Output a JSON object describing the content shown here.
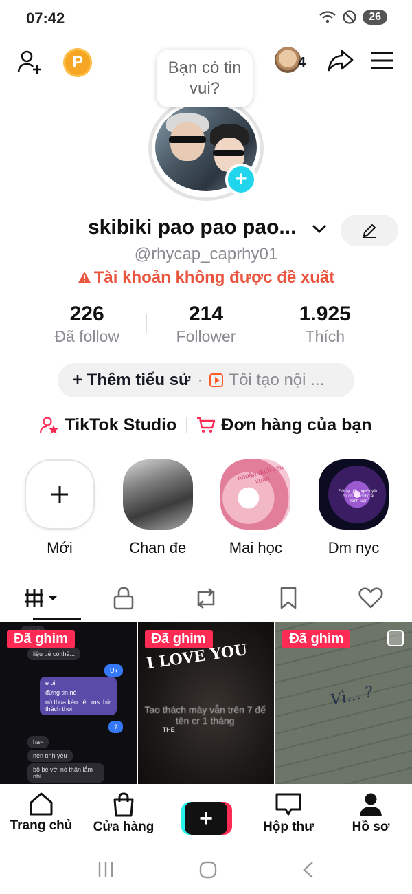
{
  "status_bar": {
    "time": "07:42",
    "battery": "26"
  },
  "top_bar": {
    "coin_label": "P",
    "friends_count": "4"
  },
  "avatar": {
    "bubble_text": "Bạn có tin vui?"
  },
  "profile": {
    "display_name": "skibiki pao pao pao...",
    "handle": "@rhycap_caprhy01",
    "warning": "Tài khoản không được đề xuất"
  },
  "stats": [
    {
      "value": "226",
      "label": "Đã follow"
    },
    {
      "value": "214",
      "label": "Follower"
    },
    {
      "value": "1.925",
      "label": "Thích"
    }
  ],
  "bio": {
    "add_label": "+ Thêm tiểu sử",
    "separator": "·",
    "creator_label": "Tôi tạo nội ..."
  },
  "links": {
    "studio": "TikTok Studio",
    "orders": "Đơn hàng của bạn"
  },
  "highlights": [
    {
      "label": "Mới"
    },
    {
      "label": "Chan đe"
    },
    {
      "label": "Mai học"
    },
    {
      "label": "Dm nyc"
    }
  ],
  "highlight_texts": {
    "mai_hoc": "nhuận đuổi cậu xuân",
    "dm_nyc": "Đời lại gặp người yêu cũ có thể cùng ai tranh luận"
  },
  "videos": [
    {
      "pin": "Đã ghim",
      "messages": [
        "pé oi",
        "liệu pé có thể...",
        "Uk",
        "e oi",
        "đừng tin nó",
        "nó thua kèo nên ms thử thách thoi",
        "?",
        "ha~",
        "nên tình yêu",
        "bộ bé với nó thân lắm nhỉ"
      ]
    },
    {
      "pin": "Đã ghim",
      "title": "I LOVE YOU",
      "caption": "Tao thách mày vẫn trên 7 để tên cr 1 tháng",
      "tag": "THE"
    },
    {
      "pin": "Đã ghim",
      "handwriting": "Vì... ?"
    }
  ],
  "bottom_nav": [
    {
      "label": "Trang chủ"
    },
    {
      "label": "Cửa hàng"
    },
    {
      "label": ""
    },
    {
      "label": "Hộp thư"
    },
    {
      "label": "Hồ sơ"
    }
  ],
  "create_button_symbol": "+",
  "accent_color": "#fe2c55",
  "warning_color": "#e9553f",
  "plus_color": "#20d5ec"
}
